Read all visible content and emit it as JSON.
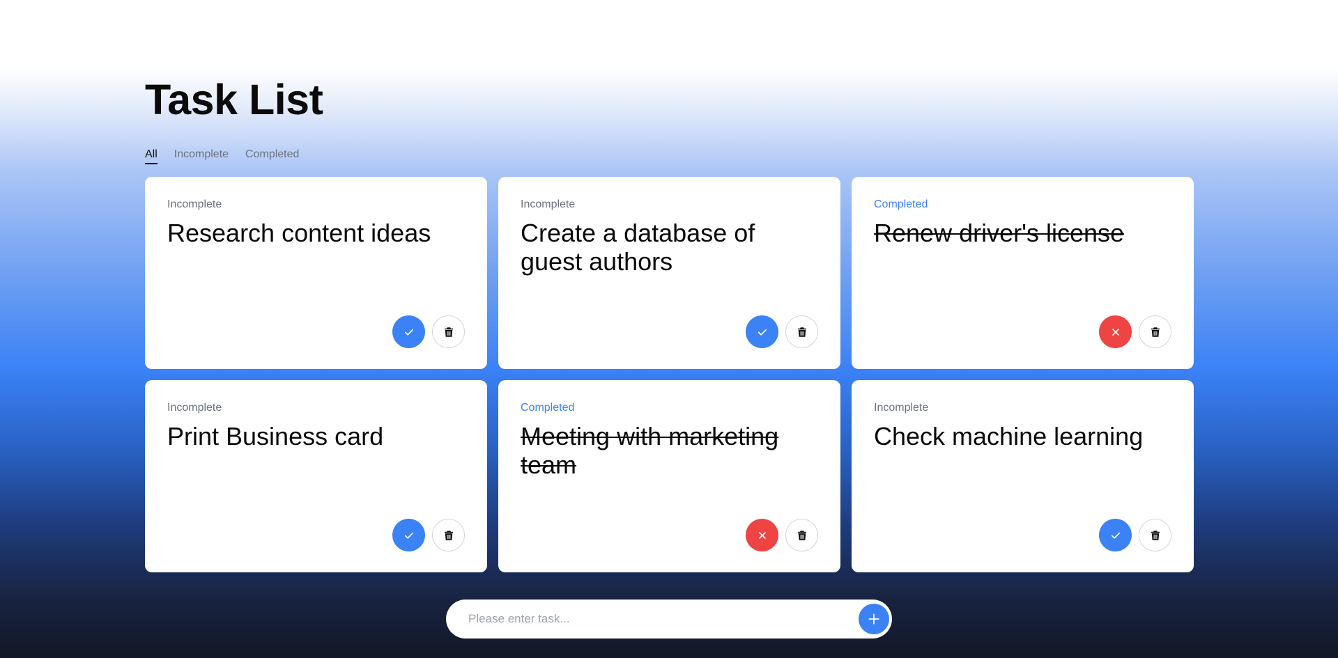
{
  "header": {
    "title": "Task List"
  },
  "filters": [
    {
      "label": "All",
      "active": true
    },
    {
      "label": "Incomplete",
      "active": false
    },
    {
      "label": "Completed",
      "active": false
    }
  ],
  "tasks": [
    {
      "status": "Incomplete",
      "title": "Research content ideas",
      "completed": false
    },
    {
      "status": "Incomplete",
      "title": "Create a database of guest authors",
      "completed": false
    },
    {
      "status": "Completed",
      "title": "Renew driver's license",
      "completed": true
    },
    {
      "status": "Incomplete",
      "title": "Print Business card",
      "completed": false
    },
    {
      "status": "Completed",
      "title": "Meeting with marketing team",
      "completed": true
    },
    {
      "status": "Incomplete",
      "title": "Check machine learning",
      "completed": false
    }
  ],
  "new_task": {
    "placeholder": "Please enter task...",
    "value": ""
  },
  "icons": {
    "complete": "check-icon",
    "undo": "close-icon",
    "delete": "trash-icon",
    "add": "plus-icon"
  },
  "colors": {
    "accent": "#3b82f6",
    "danger": "#ef4444",
    "muted": "#6b7280"
  }
}
